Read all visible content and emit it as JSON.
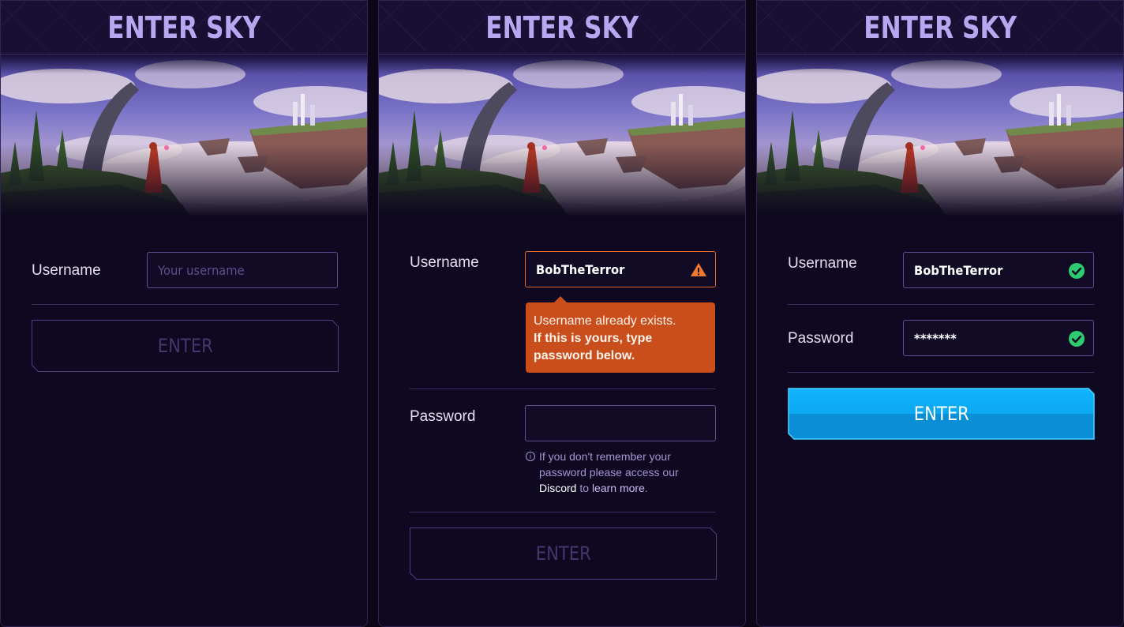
{
  "header": {
    "title": "ENTER SKY"
  },
  "colors": {
    "background": "#0e0820",
    "title": "#b6a8f0",
    "field_border": "#5d4f8f",
    "error": "#c94e1c",
    "success": "#2ecc71",
    "enter_active": "#0aa8f0"
  },
  "panel1": {
    "username_label": "Username",
    "username_placeholder": "Your username",
    "enter_label": "ENTER"
  },
  "panel2": {
    "username_label": "Username",
    "username_value": "BobTheTerror",
    "status_icon": "warning-icon",
    "error_line1": "Username already exists.",
    "error_line2": "If this is yours, type password below.",
    "password_label": "Password",
    "password_value": "",
    "hint_text_1": "If you don't remember your password please access our ",
    "hint_link_discord": "Discord",
    "hint_text_2": " to ",
    "hint_link_learn": "learn more",
    "hint_text_3": ".",
    "enter_label": "ENTER"
  },
  "panel3": {
    "username_label": "Username",
    "username_value": "BobTheTerror",
    "username_status_icon": "check-icon",
    "password_label": "Password",
    "password_value": "*******",
    "password_status_icon": "check-icon",
    "enter_label": "ENTER"
  }
}
